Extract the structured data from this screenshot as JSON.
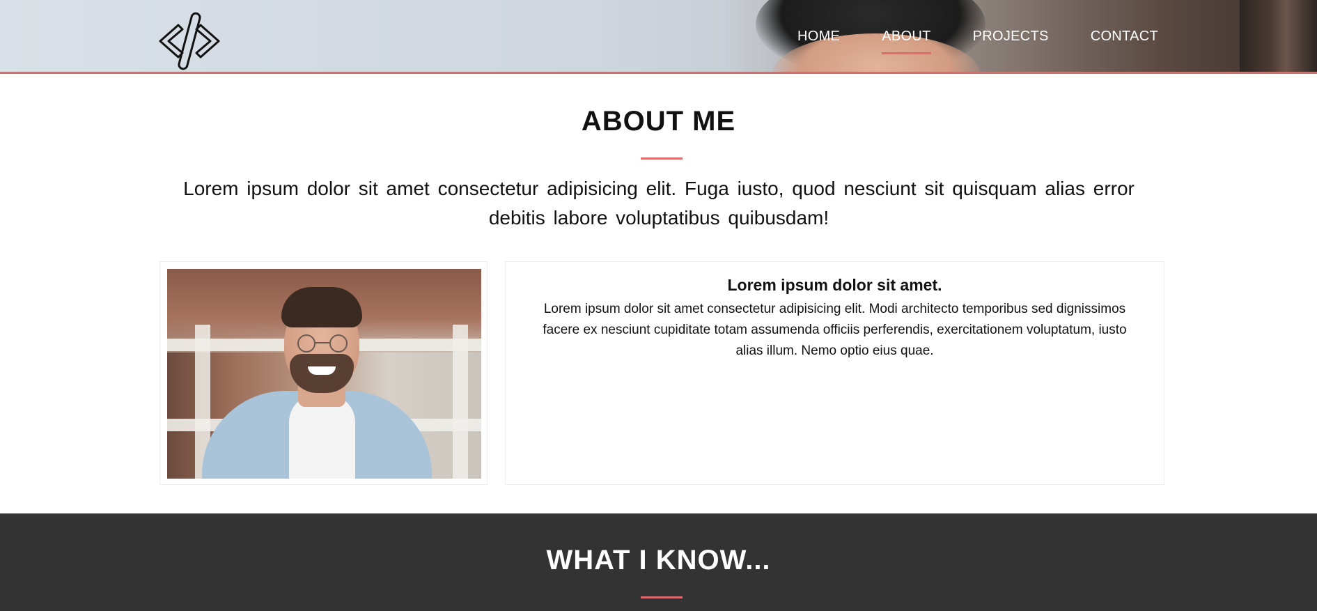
{
  "header": {
    "logo_icon": "code-brackets-icon",
    "accent_color": "#e06b6b",
    "nav": [
      {
        "label": "HOME",
        "active": false
      },
      {
        "label": "ABOUT",
        "active": true
      },
      {
        "label": "PROJECTS",
        "active": false
      },
      {
        "label": "CONTACT",
        "active": false
      }
    ]
  },
  "about": {
    "title": "ABOUT ME",
    "intro": "Lorem ipsum dolor sit amet consectetur adipisicing elit. Fuga iusto, quod nesciunt sit quisquam alias error debitis labore voluptatibus quibusdam!",
    "card": {
      "title": "Lorem ipsum dolor sit amet.",
      "body": "Lorem ipsum dolor sit amet consectetur adipisicing elit. Modi architecto temporibus sed dignissimos facere ex nesciunt cupiditate totam assumenda officiis perferendis, exercitationem voluptatum, iusto alias illum. Nemo optio eius quae."
    }
  },
  "skills": {
    "title": "WHAT I KNOW...",
    "background_color": "#333333"
  }
}
